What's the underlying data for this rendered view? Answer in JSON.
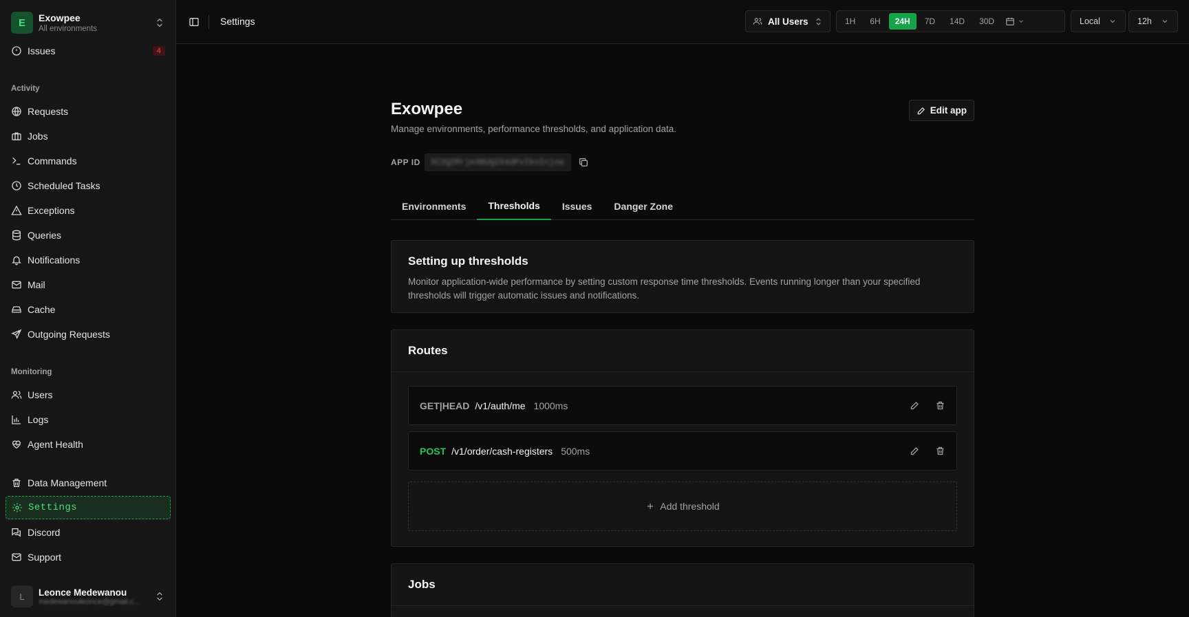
{
  "workspace": {
    "initial": "E",
    "name": "Exowpee",
    "subtitle": "All environments"
  },
  "sidebar": {
    "issues": {
      "label": "Issues",
      "count": "4"
    },
    "activity_heading": "Activity",
    "activity": [
      "Requests",
      "Jobs",
      "Commands",
      "Scheduled Tasks",
      "Exceptions",
      "Queries",
      "Notifications",
      "Mail",
      "Cache",
      "Outgoing Requests"
    ],
    "monitoring_heading": "Monitoring",
    "monitoring": [
      "Users",
      "Logs",
      "Agent Health"
    ],
    "bottom": [
      "Data Management",
      "Settings",
      "Discord",
      "Support"
    ]
  },
  "user": {
    "initial": "L",
    "name": "Leonce Medewanou",
    "email": "medewanouleonce@gmail.c..."
  },
  "topbar": {
    "title": "Settings",
    "users_filter": "All Users",
    "ranges": [
      "1H",
      "6H",
      "24H",
      "7D",
      "14D",
      "30D"
    ],
    "active_range": "24H",
    "timezone": "Local",
    "clock": "12h"
  },
  "page": {
    "title": "Exowpee",
    "description": "Manage environments, performance thresholds, and application data.",
    "edit_label": "Edit app",
    "app_id_label": "APP ID",
    "app_id_value": "3C2QZMrje4BUQZ64dPvIkoInjow"
  },
  "tabs": [
    "Environments",
    "Thresholds",
    "Issues",
    "Danger Zone"
  ],
  "active_tab": "Thresholds",
  "intro": {
    "title": "Setting up thresholds",
    "desc_line1": "Monitor application-wide performance by setting custom response time thresholds. Events running longer than your specified",
    "desc_line2": "thresholds will trigger automatic issues and notifications."
  },
  "routes": {
    "title": "Routes",
    "rows": [
      {
        "method": "GET|HEAD",
        "path": "/v1/auth/me",
        "threshold": "1000ms"
      },
      {
        "method": "POST",
        "path": "/v1/order/cash-registers",
        "threshold": "500ms"
      }
    ],
    "add_label": "Add threshold"
  },
  "jobs": {
    "title": "Jobs"
  },
  "colors": {
    "accent": "#16a34a",
    "accent_text": "#4ade80",
    "background": "#0a0a0a",
    "card": "#141414",
    "badge": "#ef4444"
  }
}
